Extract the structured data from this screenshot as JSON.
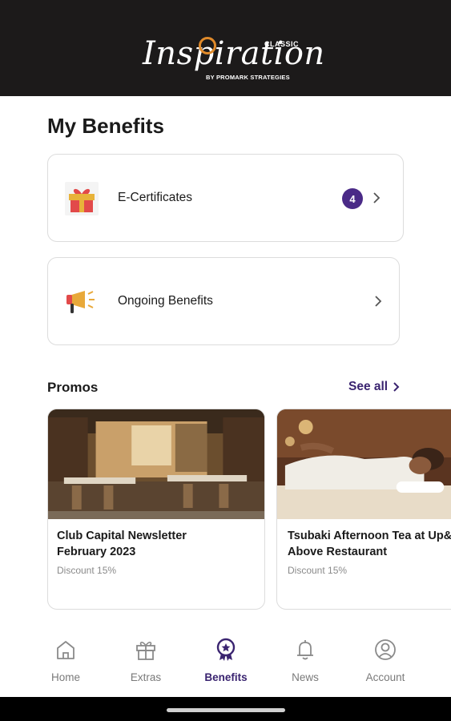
{
  "header": {
    "logo_script": "Inspiration",
    "logo_classic": "CLASSIC",
    "logo_by": "BY PROMARK STRATEGIES"
  },
  "page": {
    "title": "My Benefits"
  },
  "benefits": [
    {
      "label": "E-Certificates",
      "icon": "gift-icon",
      "badge": "4"
    },
    {
      "label": "Ongoing Benefits",
      "icon": "megaphone-icon"
    }
  ],
  "promos": {
    "title": "Promos",
    "see_all": "See all",
    "items": [
      {
        "name": "Club Capital Newsletter\nFebruary 2023",
        "discount": "Discount 15%",
        "image": "restaurant-interior-photo"
      },
      {
        "name": "Tsubaki Afternoon Tea at Up&",
        "name_line2": "Above Restaurant",
        "discount": "Discount 15%",
        "image": "spa-massage-photo"
      }
    ]
  },
  "nav": {
    "items": [
      {
        "label": "Home",
        "icon": "home-icon"
      },
      {
        "label": "Extras",
        "icon": "gift-outline-icon"
      },
      {
        "label": "Benefits",
        "icon": "award-badge-icon",
        "active": true
      },
      {
        "label": "News",
        "icon": "bell-icon"
      },
      {
        "label": "Account",
        "icon": "user-circle-icon"
      }
    ]
  },
  "colors": {
    "accent": "#4a2a87",
    "header_bg": "#1c1a1a",
    "logo_ring": "#e08a2a"
  }
}
